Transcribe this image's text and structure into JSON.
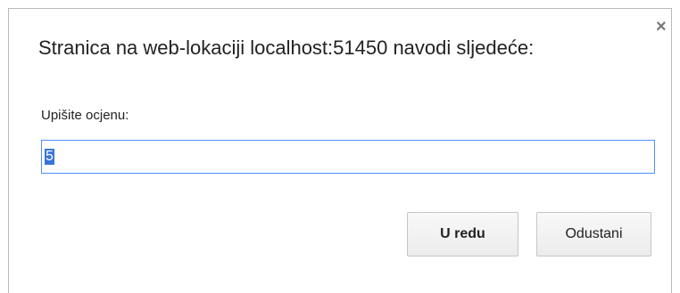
{
  "dialog": {
    "close_symbol": "×",
    "title": "Stranica na web-lokaciji localhost:51450 navodi sljedeće:",
    "prompt_label": "Upišite ocjenu:",
    "input_value": "5",
    "ok_label": "U redu",
    "cancel_label": "Odustani"
  },
  "colors": {
    "input_focus_border": "#4d90fe",
    "selection": "#3875d7"
  },
  "icons": {
    "close": "close-icon"
  }
}
